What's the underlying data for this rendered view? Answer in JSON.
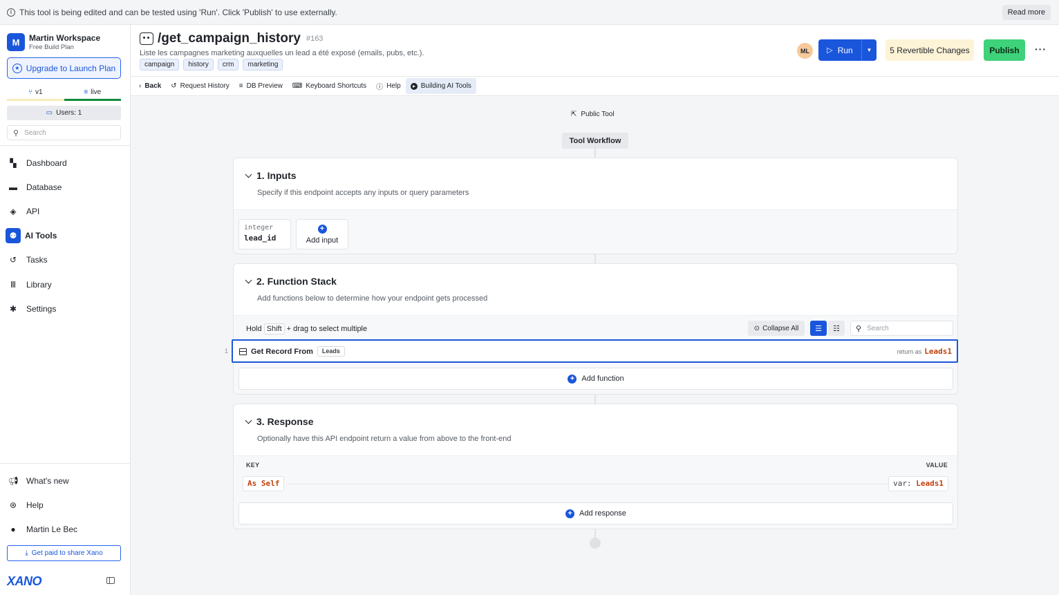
{
  "banner": {
    "text": "This tool is being edited and can be tested using 'Run'. Click 'Publish' to use externally.",
    "read_more": "Read more"
  },
  "sidebar": {
    "workspace_initial": "M",
    "workspace_name": "Martin Workspace",
    "plan": "Free Build Plan",
    "upgrade_label": "Upgrade to Launch Plan",
    "branch": "v1",
    "env": "live",
    "users": "Users: 1",
    "search_placeholder": "Search",
    "nav": [
      {
        "label": "Dashboard",
        "icon": "dashboard-icon"
      },
      {
        "label": "Database",
        "icon": "database-icon"
      },
      {
        "label": "API",
        "icon": "api-icon"
      },
      {
        "label": "AI Tools",
        "icon": "ai-tools-icon",
        "active": true
      },
      {
        "label": "Tasks",
        "icon": "tasks-icon"
      },
      {
        "label": "Library",
        "icon": "library-icon"
      },
      {
        "label": "Settings",
        "icon": "gear-icon"
      }
    ],
    "bottom_nav": [
      {
        "label": "What's new",
        "icon": "megaphone-icon"
      },
      {
        "label": "Help",
        "icon": "help-icon"
      },
      {
        "label": "Martin Le Bec",
        "icon": "user-icon"
      }
    ],
    "share_label": "Get paid to share Xano",
    "brand": "XANO"
  },
  "header": {
    "title": "/get_campaign_history",
    "id": "#163",
    "description": "Liste les campagnes marketing auxquelles un lead a été exposé (emails, pubs, etc.).",
    "tags": [
      "campaign",
      "history",
      "crm",
      "marketing"
    ],
    "avatar": "ML",
    "run_label": "Run",
    "revertible": "5 Revertible Changes",
    "publish_label": "Publish",
    "more": "···"
  },
  "toolbar": {
    "items": [
      "Back",
      "Request History",
      "DB Preview",
      "Keyboard Shortcuts",
      "Help",
      "Building AI Tools"
    ]
  },
  "canvas": {
    "public_tool": "Public Tool",
    "workflow_label": "Tool Workflow",
    "inputs": {
      "title": "1. Inputs",
      "subtitle": "Specify if this endpoint accepts any inputs or query parameters",
      "items": [
        {
          "type": "integer",
          "name": "lead_id"
        }
      ],
      "add_label": "Add input"
    },
    "function_stack": {
      "title": "2. Function Stack",
      "subtitle": "Add functions below to determine how your endpoint gets processed",
      "hold": "Hold",
      "shift": "Shift",
      "drag_text": "+ drag to select multiple",
      "collapse_all": "Collapse All",
      "search_placeholder": "Search",
      "functions": [
        {
          "index": "1",
          "name": "Get Record From",
          "table": "Leads",
          "return_label": "return as",
          "var": "Leads1"
        }
      ],
      "add_label": "Add function"
    },
    "response": {
      "title": "3. Response",
      "subtitle": "Optionally have this API endpoint return a value from above to the front-end",
      "key_header": "KEY",
      "value_header": "VALUE",
      "key": "As Self",
      "value_prefix": "var:",
      "value_var": "Leads1",
      "add_label": "Add response"
    }
  }
}
